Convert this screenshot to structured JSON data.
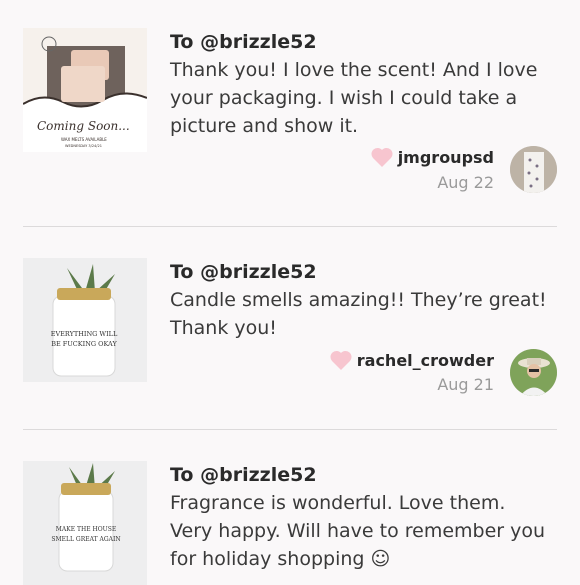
{
  "reviews": [
    {
      "to": "To @brizzle52",
      "comment": "Thank you! I love the scent! And I love your packaging. I wish I could take a picture and show it.",
      "user": "jmgroupsd",
      "date": "Aug 22",
      "thumb_text": "Coming Soon...",
      "thumb_subtext": "WAX MELTS AVAILABLE",
      "thumb_subtext2": "WEDNESDAY 3/24/21"
    },
    {
      "to": "To @brizzle52",
      "comment": "Candle smells amazing!! They’re great! Thank you!",
      "user": "rachel_crowder",
      "date": "Aug 21",
      "thumb_text": "EVERYTHING WILL",
      "thumb_text2": "BE FUCKING OKAY"
    },
    {
      "to": "To @brizzle52",
      "comment": "Fragrance is wonderful. Love them. Very happy. Will have to remember you for holiday shopping ☺",
      "thumb_text": "MAKE THE HOUSE",
      "thumb_text2": "SMELL GREAT AGAIN"
    }
  ],
  "colors": {
    "heart": "#f7c5cf",
    "divider": "#dcdadb",
    "date": "#9a9a9a",
    "background": "#faf8f9"
  }
}
